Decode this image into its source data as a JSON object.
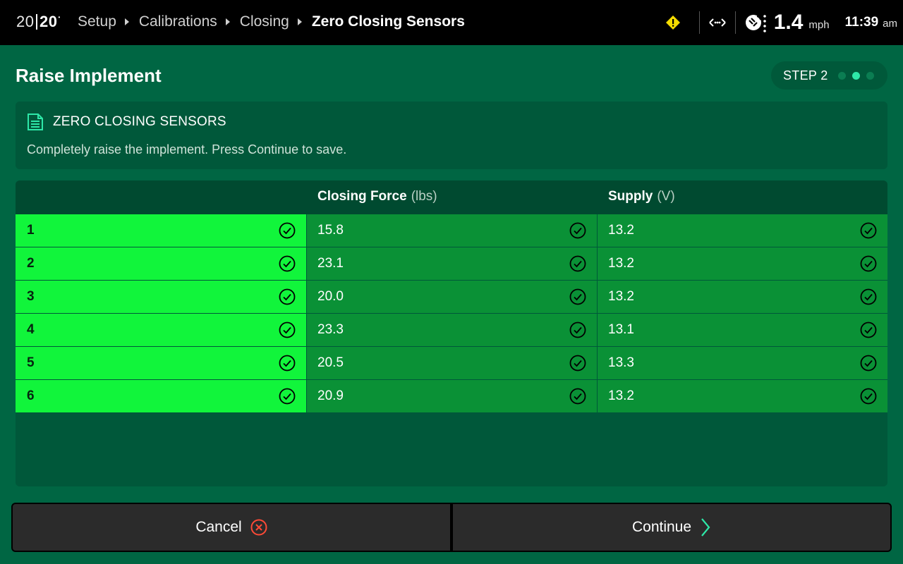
{
  "topbar": {
    "logo_left": "20",
    "logo_right": "20",
    "logo_mark": "•",
    "breadcrumbs": [
      "Setup",
      "Calibrations",
      "Closing"
    ],
    "current_page": "Zero Closing Sensors",
    "speed": "1.4",
    "speed_unit": "mph",
    "time": "11:39",
    "ampm": "am",
    "icons": [
      "warning-diamond-icon",
      "network-arrows-icon",
      "gps-satellite-icon"
    ],
    "warning_color": "#f5dc00"
  },
  "page": {
    "title": "Raise Implement",
    "step_label": "STEP 2",
    "step_total": 3,
    "step_active": 2
  },
  "info": {
    "heading": "ZERO CLOSING SENSORS",
    "text": "Completely raise the implement. Press Continue to save.",
    "icon": "document-icon"
  },
  "table": {
    "columns": [
      {
        "name": "",
        "unit": ""
      },
      {
        "name": "Closing Force",
        "unit": "(lbs)"
      },
      {
        "name": "Supply",
        "unit": "(V)"
      }
    ],
    "rows": [
      {
        "row": "1",
        "force": "15.8",
        "supply": "13.2"
      },
      {
        "row": "2",
        "force": "23.1",
        "supply": "13.2"
      },
      {
        "row": "3",
        "force": "20.0",
        "supply": "13.2"
      },
      {
        "row": "4",
        "force": "23.3",
        "supply": "13.1"
      },
      {
        "row": "5",
        "force": "20.5",
        "supply": "13.3"
      },
      {
        "row": "6",
        "force": "20.9",
        "supply": "13.2"
      }
    ],
    "status_icon": "check-circle-icon",
    "colors": {
      "row_status": "#11f53b",
      "cell_ok": "#0a9136"
    }
  },
  "buttons": {
    "cancel_label": "Cancel",
    "continue_label": "Continue"
  }
}
